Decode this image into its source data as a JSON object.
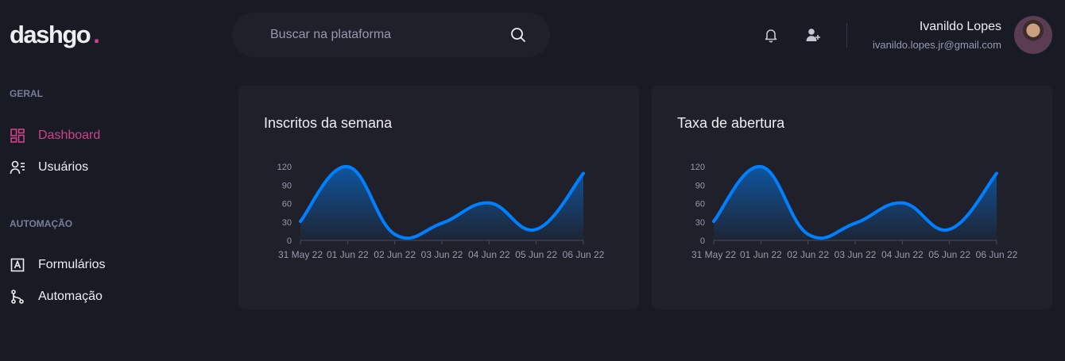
{
  "logo": {
    "text": "dashgo",
    "dot": "."
  },
  "search": {
    "placeholder": "Buscar na plataforma",
    "icon": "search-icon"
  },
  "header": {
    "icons": [
      "bell-icon",
      "user-add-icon"
    ]
  },
  "profile": {
    "name": "Ivanildo Lopes",
    "email": "ivanildo.lopes.jr@gmail.com"
  },
  "sidebar": {
    "sections": [
      {
        "title": "GERAL",
        "items": [
          {
            "label": "Dashboard",
            "icon": "dashboard-icon",
            "active": true
          },
          {
            "label": "Usuários",
            "icon": "users-icon",
            "active": false
          }
        ]
      },
      {
        "title": "AUTOMAÇÃO",
        "items": [
          {
            "label": "Formulários",
            "icon": "form-icon",
            "active": false
          },
          {
            "label": "Automação",
            "icon": "git-branch-icon",
            "active": false
          }
        ]
      }
    ]
  },
  "colors": {
    "accent": "#d53f8c",
    "series": "#0080ff",
    "background": "#181b23",
    "card": "#1f2029"
  },
  "cards": [
    {
      "title": "Inscritos da semana"
    },
    {
      "title": "Taxa de abertura"
    }
  ],
  "chart_data": [
    {
      "type": "area",
      "title": "Inscritos da semana",
      "categories": [
        "31 May 22",
        "01 Jun 22",
        "02 Jun 22",
        "03 Jun 22",
        "04 Jun 22",
        "05 Jun 22",
        "06 Jun 22"
      ],
      "series": [
        {
          "values": [
            31,
            120,
            10,
            28,
            61,
            18,
            109
          ]
        }
      ],
      "yticks": [
        0,
        30,
        60,
        90,
        120
      ],
      "ylim": [
        0,
        120
      ],
      "grid": false
    },
    {
      "type": "area",
      "title": "Taxa de abertura",
      "categories": [
        "31 May 22",
        "01 Jun 22",
        "02 Jun 22",
        "03 Jun 22",
        "04 Jun 22",
        "05 Jun 22",
        "06 Jun 22"
      ],
      "series": [
        {
          "values": [
            31,
            120,
            10,
            28,
            61,
            18,
            109
          ]
        }
      ],
      "yticks": [
        0,
        30,
        60,
        90,
        120
      ],
      "ylim": [
        0,
        120
      ],
      "grid": false
    }
  ]
}
